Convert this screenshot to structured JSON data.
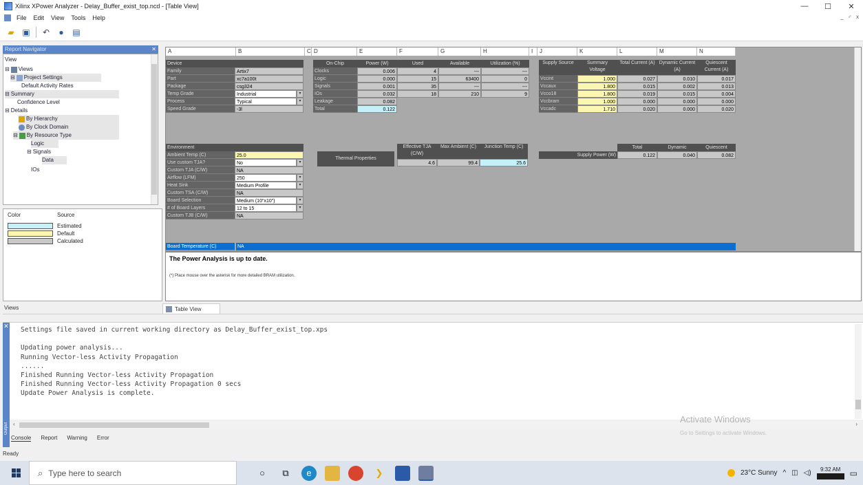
{
  "window": {
    "title": "Xilinx XPower Analyzer - Delay_Buffer_exist_top.ncd - [Table View]",
    "minimize": "—",
    "maximize": "☐",
    "close": "✕",
    "mdi_controls": "_ ♂ x"
  },
  "menu": [
    "File",
    "Edit",
    "View",
    "Tools",
    "Help"
  ],
  "navigator": {
    "header": "Report Navigator",
    "view_label": "View",
    "tree": [
      "Views",
      "Project Settings",
      "Default Activity Rates",
      "Summary",
      "Confidence Level",
      "Details",
      "By Hierarchy",
      "By Clock Domain",
      "By Resource Type",
      "Logic",
      "Signals",
      "Data",
      "IOs"
    ]
  },
  "legend": {
    "color_header": "Color",
    "source_header": "Source",
    "items": [
      {
        "label": "Estimated",
        "color": "#c5f0f7"
      },
      {
        "label": "Default",
        "color": "#fbf7b0"
      },
      {
        "label": "Calculated",
        "color": "#c8c8c8"
      }
    ]
  },
  "views_tab": "Views",
  "table": {
    "columns": [
      "A",
      "B",
      "C",
      "D",
      "E",
      "F",
      "G",
      "H",
      "I",
      "J",
      "K",
      "L",
      "M",
      "N"
    ],
    "device": {
      "header": "Device",
      "rows": [
        {
          "label": "Family",
          "value": "Artix7"
        },
        {
          "label": "Part",
          "value": "xc7a100t"
        },
        {
          "label": "Package",
          "value": "csg324"
        },
        {
          "label": "Temp Grade",
          "value": "Industrial"
        },
        {
          "label": "Process",
          "value": "Typical"
        },
        {
          "label": "Speed Grade",
          "value": "-3l"
        }
      ]
    },
    "onchip": {
      "headers": [
        "On-Chip",
        "Power (W)",
        "Used",
        "Available",
        "Utilization (%)"
      ],
      "rows": [
        {
          "label": "Clocks",
          "power": "0.006",
          "used": "4",
          "avail": "---",
          "util": "---"
        },
        {
          "label": "Logic",
          "power": "0.000",
          "used": "15",
          "avail": "63400",
          "util": "0"
        },
        {
          "label": "Signals",
          "power": "0.001",
          "used": "35",
          "avail": "---",
          "util": "---"
        },
        {
          "label": "IOs",
          "power": "0.032",
          "used": "18",
          "avail": "210",
          "util": "9"
        },
        {
          "label": "Leakage",
          "power": "0.082",
          "used": "",
          "avail": "",
          "util": ""
        },
        {
          "label": "Total",
          "power": "0.122",
          "used": "",
          "avail": "",
          "util": ""
        }
      ]
    },
    "supply_summary": {
      "headers": [
        "Supply Source",
        "Summary Voltage",
        "Total Current (A)",
        "Dynamic Current (A)",
        "Quiescent Current (A)"
      ],
      "rows": [
        {
          "src": "Vccint",
          "v": "1.000",
          "t": "0.027",
          "d": "0.010",
          "q": "0.017"
        },
        {
          "src": "Vccaux",
          "v": "1.800",
          "t": "0.015",
          "d": "0.002",
          "q": "0.013"
        },
        {
          "src": "Vcco18",
          "v": "1.800",
          "t": "0.019",
          "d": "0.015",
          "q": "0.004"
        },
        {
          "src": "Vccbram",
          "v": "1.000",
          "t": "0.000",
          "d": "0.000",
          "q": "0.000"
        },
        {
          "src": "Vccadc",
          "v": "1.710",
          "t": "0.020",
          "d": "0.000",
          "q": "0.020"
        }
      ]
    },
    "environment": {
      "header": "Environment",
      "rows": [
        {
          "label": "Ambient Temp (C)",
          "value": "25.0"
        },
        {
          "label": "Use custom TJA?",
          "value": "No"
        },
        {
          "label": "Custom TJA (C/W)",
          "value": "NA"
        },
        {
          "label": "Airflow (LFM)",
          "value": "250"
        },
        {
          "label": "Heat Sink",
          "value": "Medium Profile"
        },
        {
          "label": "Custom TSA (C/W)",
          "value": "NA"
        },
        {
          "label": "Board Selection",
          "value": "Medium (10\"x10\")"
        },
        {
          "label": "# of Board Layers",
          "value": "12 to 15"
        },
        {
          "label": "Custom TJB (C/W)",
          "value": "NA"
        },
        {
          "label": "Board Temperature (C)",
          "value": "NA"
        }
      ]
    },
    "thermal": {
      "label": "Thermal Properties",
      "headers": [
        "Effective TJA (C/W)",
        "Max Ambient (C)",
        "Junction Temp (C)"
      ],
      "values": [
        "4.6",
        "99.4",
        "25.6"
      ]
    },
    "supply_power": {
      "label": "Supply Power (W)",
      "headers": [
        "Total",
        "Dynamic",
        "Quiescent"
      ],
      "values": [
        "0.122",
        "0.040",
        "0.082"
      ]
    }
  },
  "status": {
    "message": "The Power Analysis is up to date.",
    "note": "(*) Place mouse over the asterisk for more detailed BRAM utilization."
  },
  "tab_table_view": "Table View",
  "console": {
    "lines": [
      "Settings file saved in current working directory as Delay_Buffer_exist_top.xps",
      "",
      "Updating power analysis...",
      "Running Vector-less Activity Propagation",
      "......",
      "Finished Running Vector-less Activity Propagation",
      "Finished Running Vector-less Activity Propagation 0 secs",
      "Update Power Analysis is complete."
    ],
    "tabs": [
      "Console",
      "Report",
      "Warning",
      "Error"
    ],
    "side_label": "Output"
  },
  "status_bar": "Ready",
  "watermark": {
    "title": "Activate Windows",
    "subtitle": "Go to Settings to activate Windows."
  },
  "taskbar": {
    "search_placeholder": "Type here to search",
    "weather": "23°C  Sunny",
    "time": "9:32 AM"
  }
}
